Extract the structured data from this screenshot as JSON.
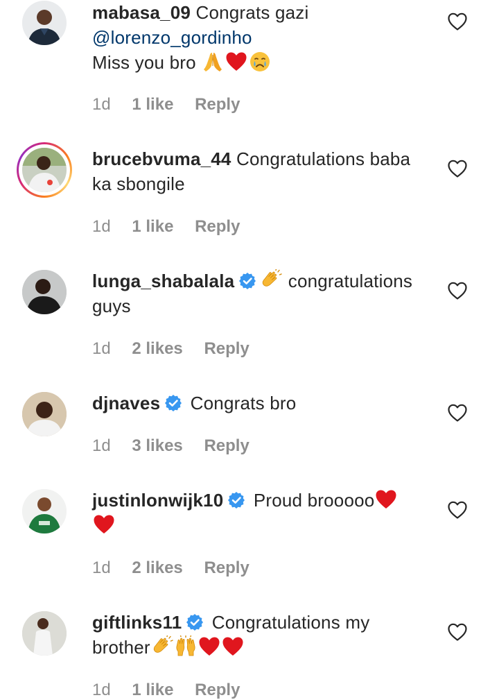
{
  "comments": [
    {
      "username": "mabasa_09",
      "verified": false,
      "lines": [
        "Congrats gazi"
      ],
      "mention": "@lorenzo_gordinho",
      "tail": "Miss you bro",
      "time": "1d",
      "likes": "1 like",
      "reply": "Reply",
      "emojis": [
        "folded-hands-emoji",
        "red-heart-emoji",
        "crying-face-emoji"
      ]
    },
    {
      "username": "brucebvuma_44",
      "verified": false,
      "has_story": true,
      "text1": "Congratulations baba",
      "text2": "ka sbongile",
      "time": "1d",
      "likes": "1 like",
      "reply": "Reply"
    },
    {
      "username": "lunga_shabalala",
      "verified": true,
      "text1": "congratulations",
      "text2": "guys",
      "time": "1d",
      "likes": "2 likes",
      "reply": "Reply",
      "emojis": [
        "clapping-hands-emoji"
      ]
    },
    {
      "username": "djnaves",
      "verified": true,
      "text1": "Congrats bro",
      "time": "1d",
      "likes": "3 likes",
      "reply": "Reply"
    },
    {
      "username": "justinlonwijk10",
      "verified": true,
      "text1": "Proud brooooo",
      "time": "1d",
      "likes": "2 likes",
      "reply": "Reply",
      "emojis": [
        "red-heart-emoji",
        "red-heart-emoji"
      ]
    },
    {
      "username": "giftlinks11",
      "verified": true,
      "text1": "Congratulations my",
      "text2": "brother",
      "time": "1d",
      "likes": "1 like",
      "reply": "Reply",
      "emojis": [
        "clapping-hands-emoji",
        "raising-hands-emoji",
        "red-heart-emoji",
        "red-heart-emoji"
      ]
    }
  ],
  "colors": {
    "text": "#262626",
    "secondary": "#8e8e8e",
    "mention": "#00376b",
    "verified_blue": "#3897f0",
    "heart_red": "#e0161e"
  },
  "icons": {
    "like": "heart-outline-icon",
    "verified": "verified-badge-icon"
  }
}
